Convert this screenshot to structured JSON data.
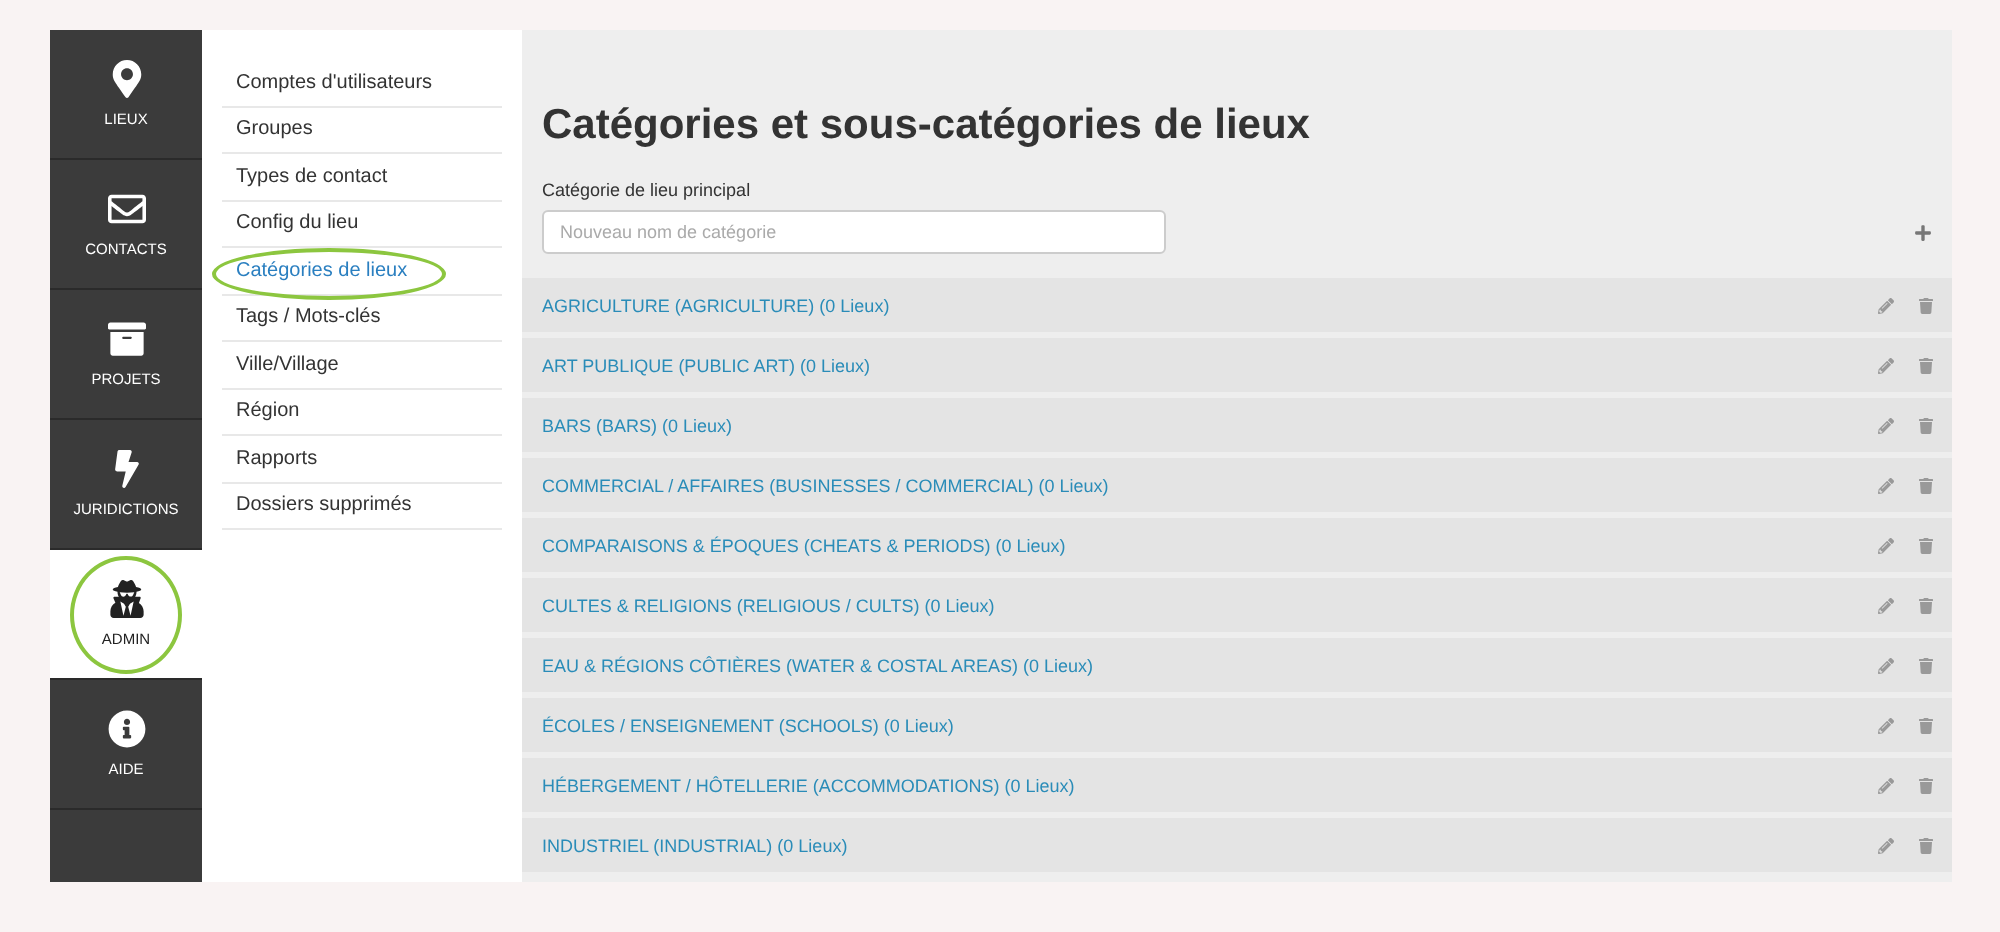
{
  "nav": [
    {
      "label": "LIEUX",
      "selected": false,
      "circled": false
    },
    {
      "label": "CONTACTS",
      "selected": false,
      "circled": false
    },
    {
      "label": "PROJETS",
      "selected": false,
      "circled": false
    },
    {
      "label": "JURIDICTIONS",
      "selected": false,
      "circled": false
    },
    {
      "label": "ADMIN",
      "selected": true,
      "circled": true
    },
    {
      "label": "AIDE",
      "selected": false,
      "circled": false
    }
  ],
  "submenu": [
    {
      "label": "Comptes d'utilisateurs",
      "selected": false,
      "circled": false
    },
    {
      "label": "Groupes",
      "selected": false,
      "circled": false
    },
    {
      "label": "Types de contact",
      "selected": false,
      "circled": false
    },
    {
      "label": "Config du lieu",
      "selected": false,
      "circled": false
    },
    {
      "label": "Catégories de lieux",
      "selected": true,
      "circled": true
    },
    {
      "label": "Tags / Mots-clés",
      "selected": false,
      "circled": false
    },
    {
      "label": "Ville/Village",
      "selected": false,
      "circled": false
    },
    {
      "label": "Région",
      "selected": false,
      "circled": false
    },
    {
      "label": "Rapports",
      "selected": false,
      "circled": false
    },
    {
      "label": "Dossiers supprimés",
      "selected": false,
      "circled": false
    }
  ],
  "page_title": "Catégories et sous-catégories de lieux",
  "new_category": {
    "label": "Catégorie de lieu principal",
    "placeholder": "Nouveau nom de catégorie"
  },
  "categories": [
    "AGRICULTURE (AGRICULTURE) (0 Lieux)",
    "ART PUBLIQUE (PUBLIC ART) (0 Lieux)",
    "BARS (BARS) (0 Lieux)",
    "COMMERCIAL / AFFAIRES (BUSINESSES / COMMERCIAL) (0 Lieux)",
    "COMPARAISONS & ÉPOQUES (CHEATS & PERIODS) (0 Lieux)",
    "CULTES & RELIGIONS (RELIGIOUS / CULTS) (0 Lieux)",
    "EAU & RÉGIONS CÔTIÈRES (WATER & COSTAL AREAS) (0 Lieux)",
    "ÉCOLES / ENSEIGNEMENT (SCHOOLS) (0 Lieux)",
    "HÉBERGEMENT / HÔTELLERIE (ACCOMMODATIONS) (0 Lieux)",
    "INDUSTRIEL (INDUSTRIAL) (0 Lieux)"
  ]
}
